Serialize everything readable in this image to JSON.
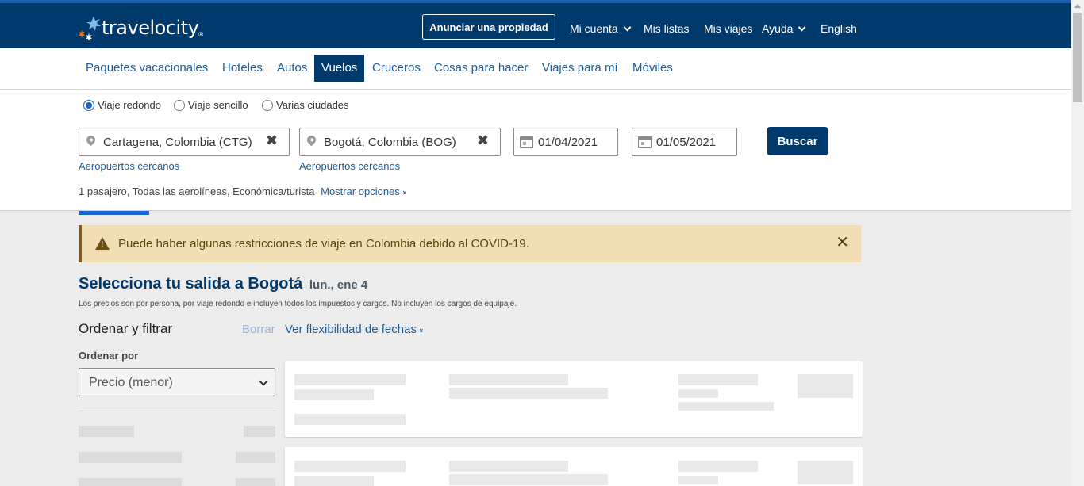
{
  "header": {
    "logo_text": "travelocity",
    "logo_tm": "®",
    "post_property": "Anunciar una propiedad",
    "links": [
      {
        "label": "Mi cuenta",
        "dropdown": true
      },
      {
        "label": "Mis listas",
        "dropdown": false
      },
      {
        "label": "Mis viajes",
        "dropdown": false
      },
      {
        "label": "Ayuda",
        "dropdown": true
      },
      {
        "label": "English",
        "dropdown": false
      }
    ]
  },
  "nav": {
    "items": [
      "Paquetes vacacionales",
      "Hoteles",
      "Autos",
      "Vuelos",
      "Cruceros",
      "Cosas para hacer",
      "Viajes para mí",
      "Móviles"
    ],
    "active": "Vuelos"
  },
  "search": {
    "trip_types": [
      {
        "label": "Viaje redondo",
        "selected": true
      },
      {
        "label": "Viaje sencillo",
        "selected": false
      },
      {
        "label": "Varias ciudades",
        "selected": false
      }
    ],
    "origin": "Cartagena, Colombia (CTG)",
    "destination": "Bogotá, Colombia (BOG)",
    "depart_date": "01/04/2021",
    "return_date": "01/05/2021",
    "nearby_airports": "Aeropuertos cercanos",
    "search_button": "Buscar",
    "passenger_summary": "1 pasajero, Todas las aerolíneas, Económica/turista",
    "show_options": "Mostrar opciones"
  },
  "alert": {
    "text": "Puede haber algunas restricciones de viaje en Colombia debido al COVID-19."
  },
  "results": {
    "title": "Selecciona tu salida a Bogotá",
    "date": "lun., ene 4",
    "disclaimer": "Los precios son por persona, por viaje redondo e incluyen todos los impuestos y cargos. No incluyen los cargos de equipaje.",
    "sort_filter": "Ordenar y filtrar",
    "clear": "Borrar",
    "flex_dates": "Ver flexibilidad de fechas",
    "sort_by_label": "Ordenar por",
    "sort_by_value": "Precio (menor)"
  },
  "colors": {
    "brand_dark": "#00396c",
    "link": "#1e5c98",
    "alert_bg": "#f2deb4",
    "page_bg": "#ececec"
  }
}
